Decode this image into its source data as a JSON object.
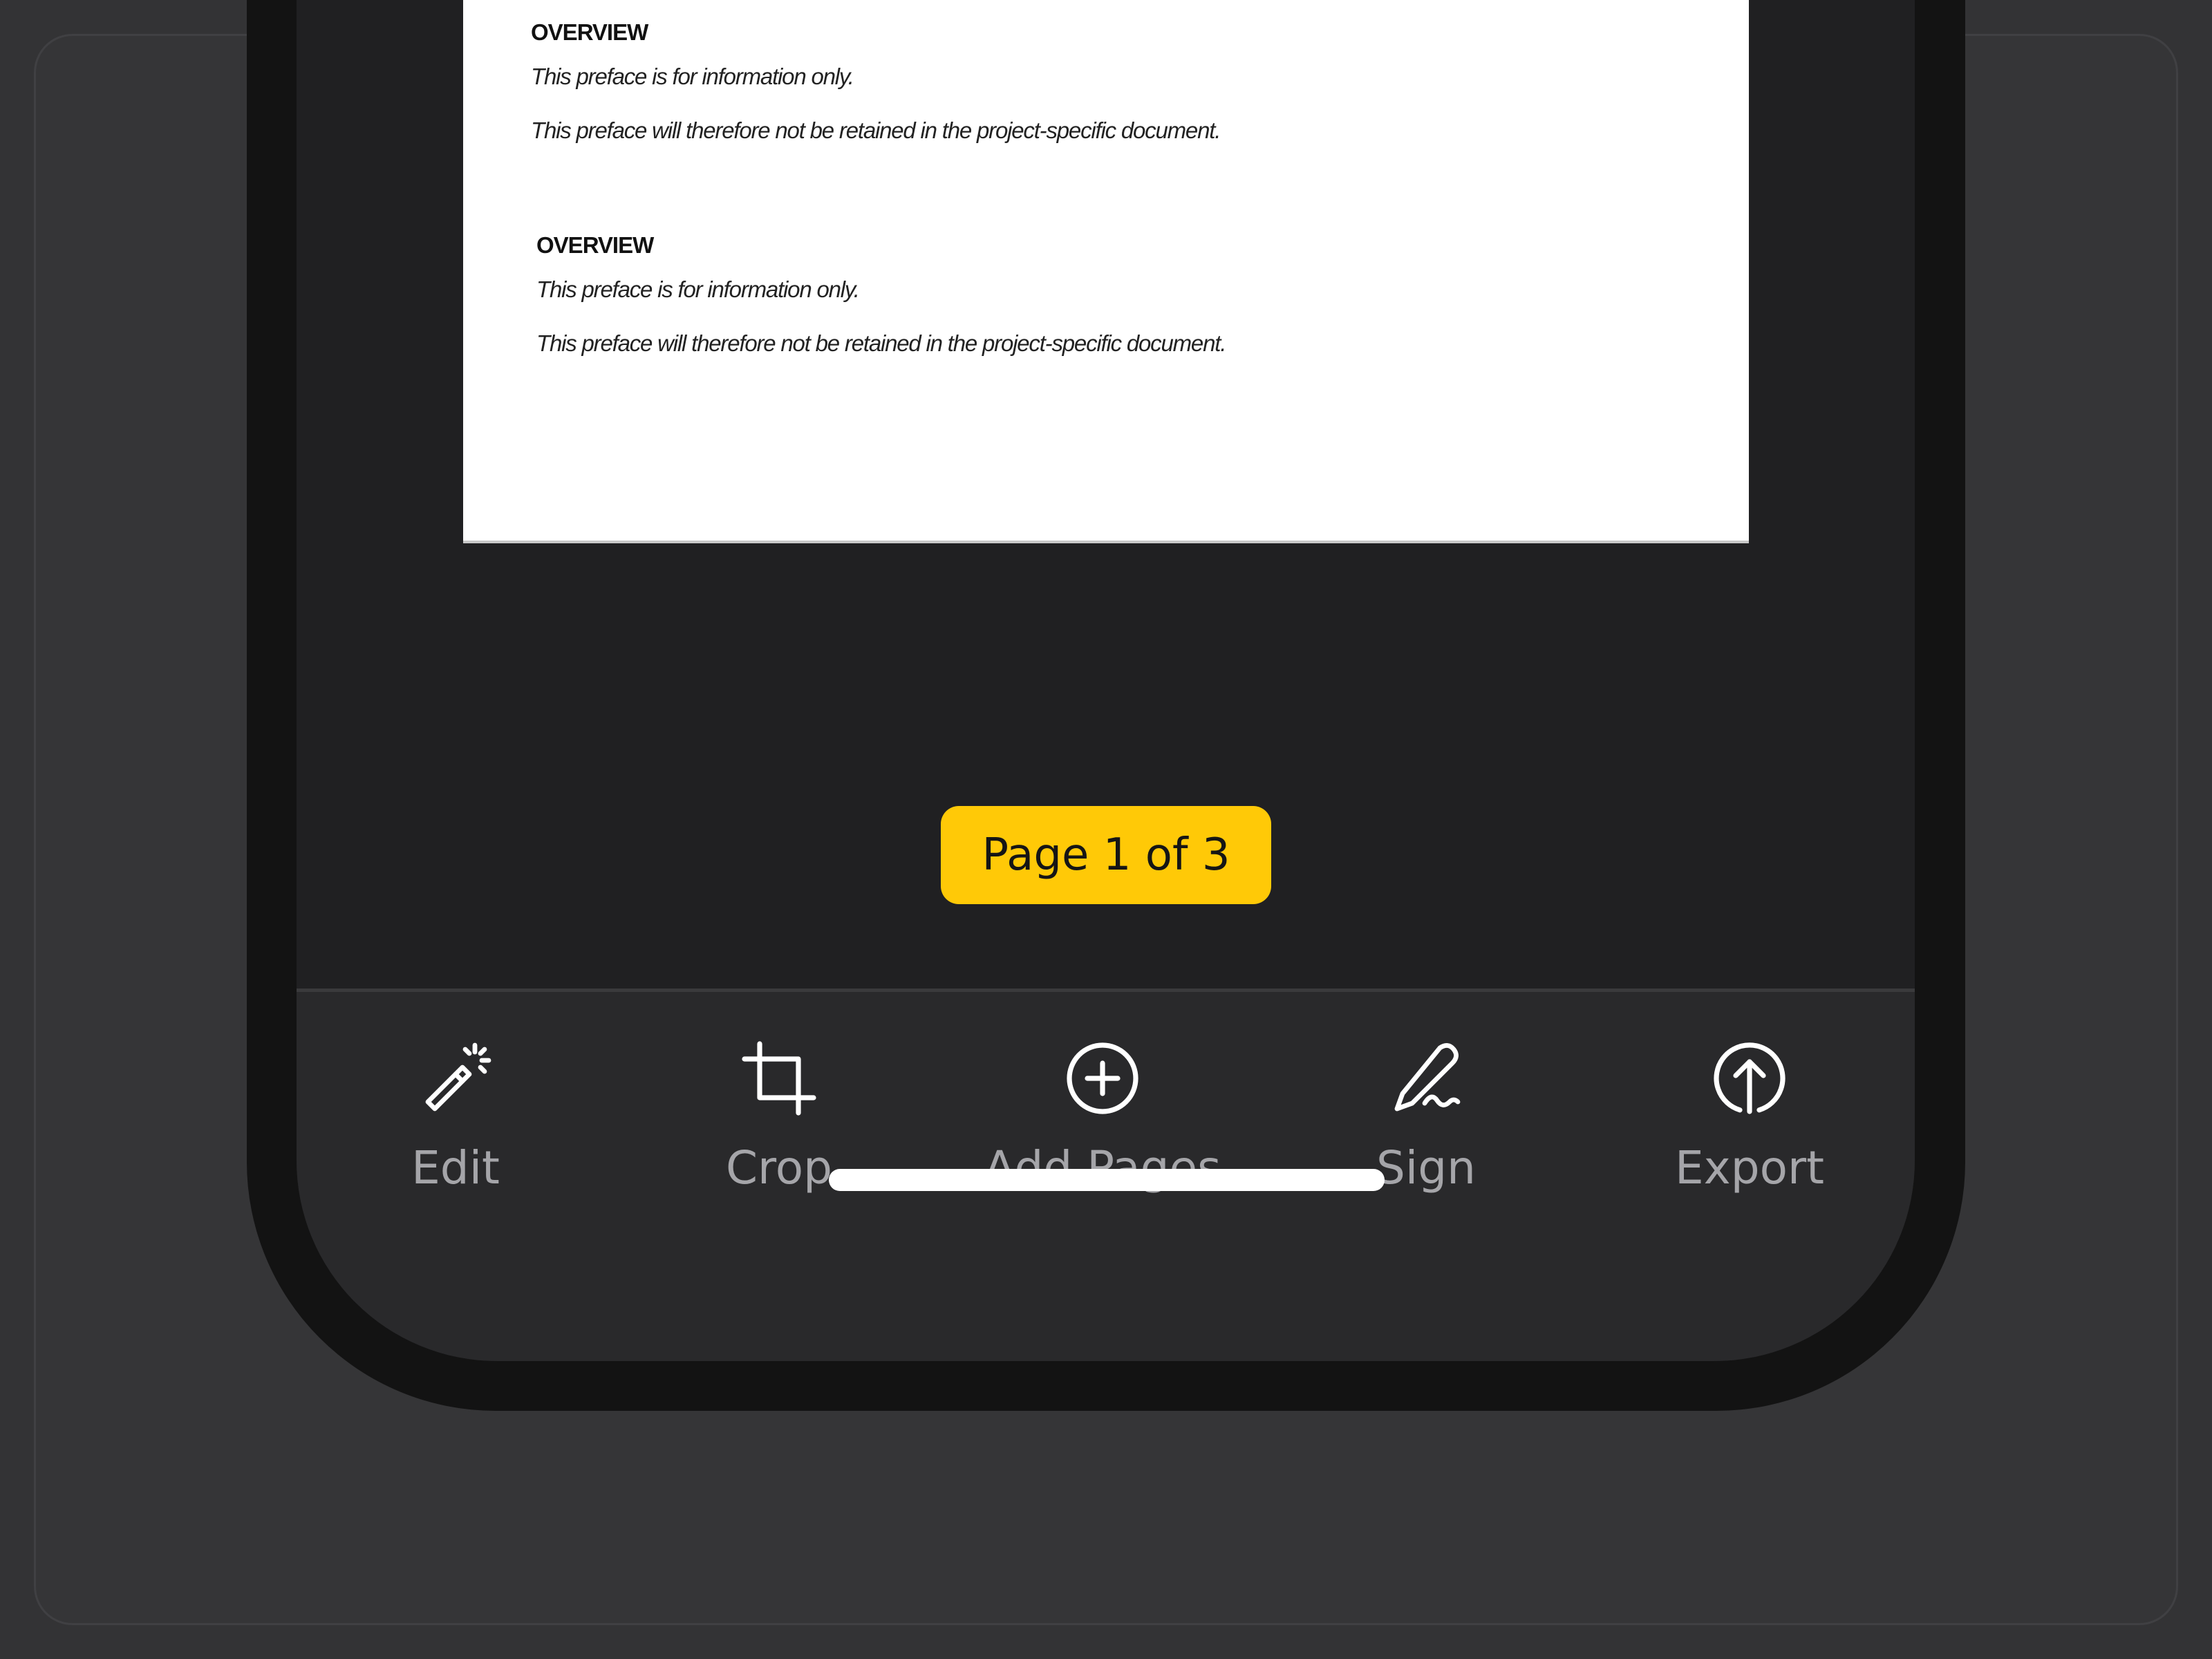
{
  "document": {
    "sections": [
      {
        "heading": "OVERVIEW",
        "lines": [
          "This preface is for information only.",
          "This preface will therefore not be retained in the project-specific document."
        ]
      },
      {
        "heading": "OVERVIEW",
        "lines": [
          "This preface is for information only.",
          "This preface will therefore not be retained in the project-specific document."
        ]
      }
    ]
  },
  "pager": {
    "label": "Page 1 of 3",
    "current_page": 1,
    "total_pages": 3
  },
  "toolbar": {
    "items": [
      {
        "label": "Edit",
        "icon": "magic-wand-icon"
      },
      {
        "label": "Crop",
        "icon": "crop-icon"
      },
      {
        "label": "Add Pages",
        "icon": "plus-circle-icon"
      },
      {
        "label": "Sign",
        "icon": "signature-pen-icon"
      },
      {
        "label": "Export",
        "icon": "upload-arrow-icon"
      }
    ]
  },
  "colors": {
    "background": "#333335",
    "screen": "#202022",
    "toolbar": "#29292b",
    "accent": "#ffc907",
    "label": "#a5a5a9",
    "icon": "#ffffff"
  }
}
